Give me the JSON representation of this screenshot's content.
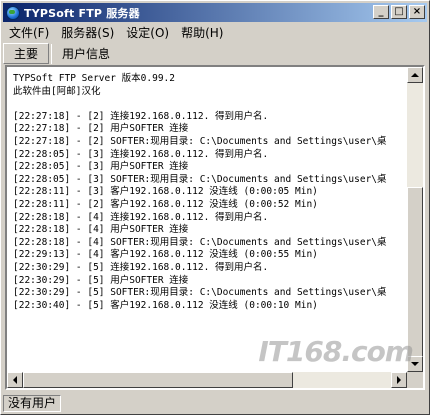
{
  "window": {
    "title": "TYPSoft FTP 服务器",
    "minimize": "_",
    "maximize": "□",
    "close": "×"
  },
  "menu": [
    "文件(F)",
    "服务器(S)",
    "设定(O)",
    "帮助(H)"
  ],
  "tabs": [
    {
      "label": "主要",
      "active": true
    },
    {
      "label": "用户信息",
      "active": false
    }
  ],
  "log": {
    "lines": [
      "TYPSoft FTP Server 版本0.99.2",
      "此软件由[阿邮]汉化",
      "",
      "[22:27:18] - [2] 连接192.168.0.112. 得到用户名.",
      "[22:27:18] - [2] 用户SOFTER 连接",
      "[22:27:18] - [2] SOFTER:现用目录: C:\\Documents and Settings\\user\\桌",
      "[22:28:05] - [3] 连接192.168.0.112. 得到用户名.",
      "[22:28:05] - [3] 用户SOFTER 连接",
      "[22:28:05] - [3] SOFTER:现用目录: C:\\Documents and Settings\\user\\桌",
      "[22:28:11] - [3] 客户192.168.0.112 没连线 (0:00:05 Min)",
      "[22:28:11] - [2] 客户192.168.0.112 没连线 (0:00:52 Min)",
      "[22:28:18] - [4] 连接192.168.0.112. 得到用户名.",
      "[22:28:18] - [4] 用户SOFTER 连接",
      "[22:28:18] - [4] SOFTER:现用目录: C:\\Documents and Settings\\user\\桌",
      "[22:29:13] - [4] 客户192.168.0.112 没连线 (0:00:55 Min)",
      "[22:30:29] - [5] 连接192.168.0.112. 得到用户名.",
      "[22:30:29] - [5] 用户SOFTER 连接",
      "[22:30:29] - [5] SOFTER:现用目录: C:\\Documents and Settings\\user\\桌",
      "[22:30:40] - [5] 客户192.168.0.112 没连线 (0:00:10 Min)"
    ]
  },
  "status": {
    "users": "没有用户"
  },
  "watermark": {
    "text": "IT168.com"
  }
}
